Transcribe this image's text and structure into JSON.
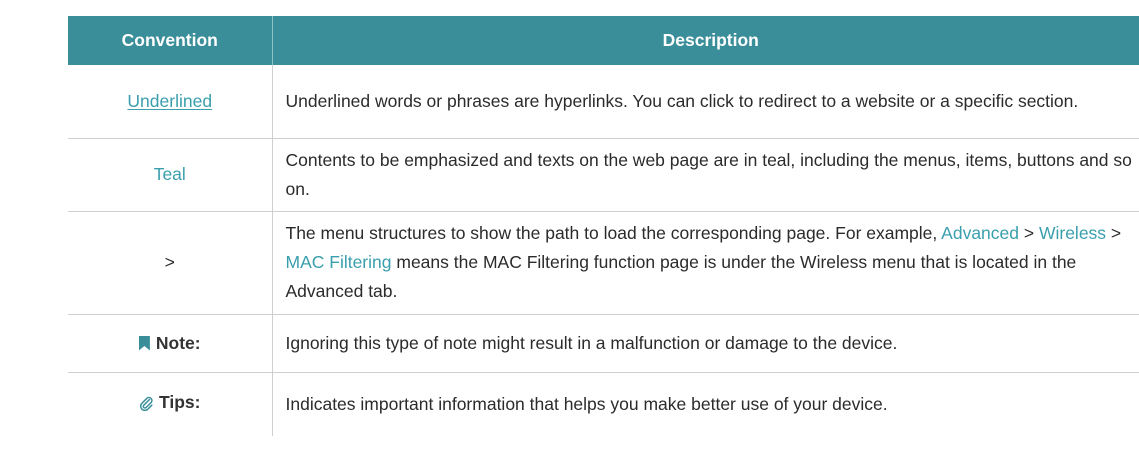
{
  "header": {
    "convention": "Convention",
    "description": "Description"
  },
  "rows": [
    {
      "convention": "Underlined",
      "description": "Underlined words or phrases are hyperlinks. You can click to redirect to a website or a specific section."
    },
    {
      "convention": "Teal",
      "description": "Contents to be emphasized and texts on the web page are in teal, including the menus, items, buttons and so on."
    },
    {
      "convention": ">",
      "description_parts": {
        "intro": "The menu structures to show the path to load the corresponding page. For example,",
        "path_1": "Advanced",
        "sep_1": " > ",
        "path_2": "Wireless",
        "sep_2": " > ",
        "path_3": "MAC Filtering",
        "tail": " means the MAC Filtering function page is under the Wireless menu that is located in the Advanced tab."
      }
    },
    {
      "convention": "Note:",
      "description": "Ignoring this type of note might result in a malfunction or damage to the device."
    },
    {
      "convention": "Tips:",
      "description": "Indicates important information that helps you make better use of your device."
    }
  ],
  "icons": {
    "note": "bookmark-icon",
    "tips": "paperclip-icon"
  },
  "colors": {
    "header_bg": "#3a8e99",
    "teal_text": "#3a9fad",
    "border": "#cfcfcf"
  }
}
